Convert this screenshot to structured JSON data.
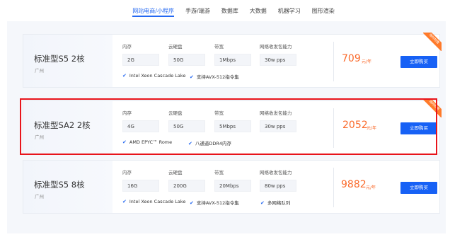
{
  "tabs": [
    "网站电商/小程序",
    "手游/端游",
    "数据库",
    "大数据",
    "机器学习",
    "图形渲染"
  ],
  "spec_labels": [
    "内存",
    "云硬盘",
    "带宽",
    "网络收发包能力"
  ],
  "buy_label": "立即购买",
  "ribbon_label": "限时特惠",
  "cards": [
    {
      "name": "标准型S5 2核",
      "region": "广州",
      "specs": [
        "2G",
        "50G",
        "1Mbps",
        "30w pps"
      ],
      "features": [
        "Intel Xeon Cascade Lake",
        "支持AVX-512指令集"
      ],
      "price": "709",
      "unit": "元/年",
      "ribbon": true
    },
    {
      "name": "标准型SA2 2核",
      "region": "广州",
      "specs": [
        "4G",
        "50G",
        "5Mbps",
        "30w pps"
      ],
      "features": [
        "AMD EPYC™ Rome",
        "八通道DDR4内存"
      ],
      "price": "2052",
      "unit": "元/年",
      "ribbon": true
    },
    {
      "name": "标准型S5 8核",
      "region": "广州",
      "specs": [
        "16G",
        "200G",
        "20Mbps",
        "80w pps"
      ],
      "features": [
        "Intel Xeon Cascade Lake",
        "支持AVX-512指令集",
        "多网络队列"
      ],
      "price": "9882",
      "unit": "元/年",
      "ribbon": false
    }
  ]
}
